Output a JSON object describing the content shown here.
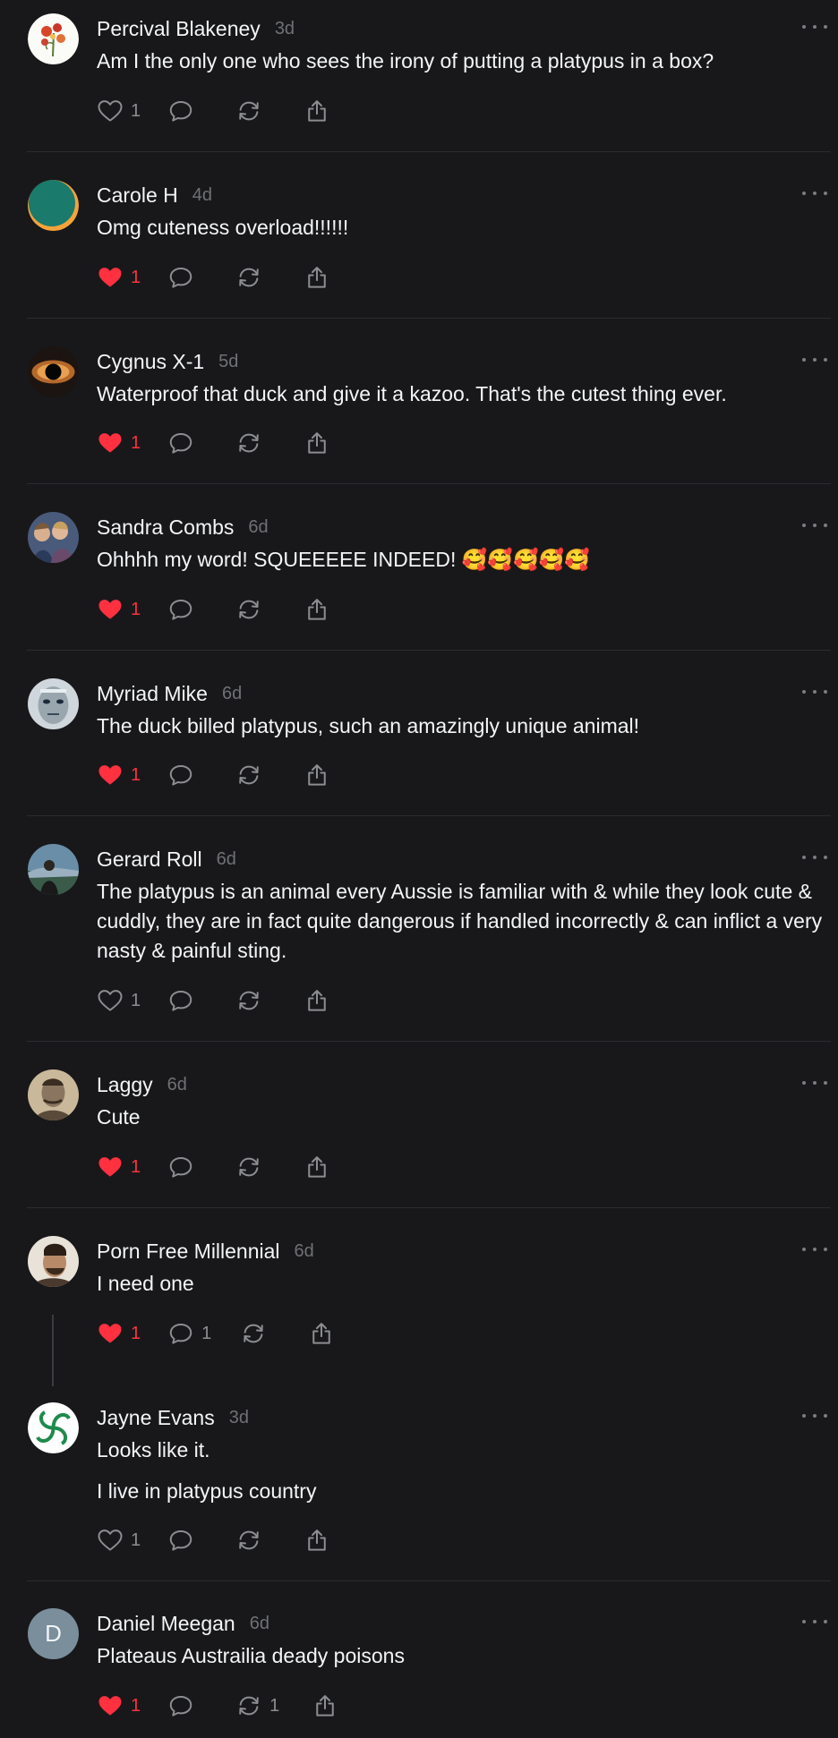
{
  "posts": [
    {
      "author": "Percival Blakeney",
      "time": "3d",
      "text": [
        "Am I the only one who sees the irony of putting a platypus in a box?"
      ],
      "likes": "1",
      "liked": false,
      "replies": "",
      "reposts": "",
      "avatar": "flower-avatar"
    },
    {
      "author": "Carole H",
      "time": "4d",
      "text": [
        "Omg cuteness overload!!!!!!"
      ],
      "likes": "1",
      "liked": true,
      "replies": "",
      "reposts": "",
      "avatar": "circle-avatar"
    },
    {
      "author": "Cygnus X-1",
      "time": "5d",
      "text": [
        "Waterproof that duck and give it a kazoo. That's the cutest thing ever."
      ],
      "likes": "1",
      "liked": true,
      "replies": "",
      "reposts": "",
      "avatar": "blackhole-avatar"
    },
    {
      "author": "Sandra Combs",
      "time": "6d",
      "text": [
        "Ohhhh my word! SQUEEEEE INDEED! 🥰🥰🥰🥰🥰"
      ],
      "likes": "1",
      "liked": true,
      "replies": "",
      "reposts": "",
      "avatar": "group-photo-avatar"
    },
    {
      "author": "Myriad Mike",
      "time": "6d",
      "text": [
        "The duck billed platypus, such an amazingly unique animal!"
      ],
      "likes": "1",
      "liked": true,
      "replies": "",
      "reposts": "",
      "avatar": "face-avatar"
    },
    {
      "author": "Gerard Roll",
      "time": "6d",
      "text": [
        "The platypus is an animal every Aussie is familiar with & while they look cute & cuddly, they are in fact quite dangerous if handled incorrectly & can inflict a very nasty & painful sting."
      ],
      "likes": "1",
      "liked": false,
      "replies": "",
      "reposts": "",
      "avatar": "landscape-avatar"
    },
    {
      "author": "Laggy",
      "time": "6d",
      "text": [
        "Cute"
      ],
      "likes": "1",
      "liked": true,
      "replies": "",
      "reposts": "",
      "avatar": "portrait-avatar"
    },
    {
      "author": "Porn Free Millennial",
      "time": "6d",
      "text": [
        "I need one"
      ],
      "likes": "1",
      "liked": true,
      "replies": "1",
      "reposts": "",
      "avatar": "man-avatar"
    },
    {
      "author": "Jayne Evans",
      "time": "3d",
      "text": [
        "Looks like it.",
        "I live in platypus country"
      ],
      "likes": "1",
      "liked": false,
      "replies": "",
      "reposts": "",
      "avatar": "swirl-avatar"
    },
    {
      "author": "Daniel Meegan",
      "time": "6d",
      "text": [
        "Plateaus Austrailia deady poisons"
      ],
      "likes": "1",
      "liked": true,
      "replies": "",
      "reposts": "1",
      "avatar": "initial-avatar",
      "initial": "D"
    }
  ],
  "colors": {
    "like": "#ff3040",
    "background": "#18181a",
    "muted": "#6f7174"
  }
}
